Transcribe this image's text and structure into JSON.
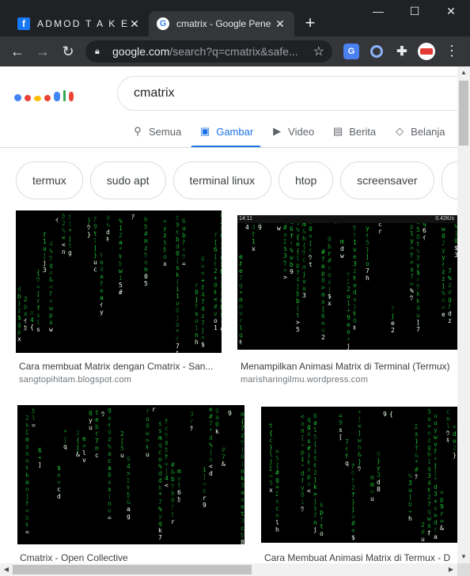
{
  "browser": {
    "tabs": [
      {
        "title": "ADMOD T A K E W A",
        "favicon": "facebook-icon"
      },
      {
        "title": "cmatrix - Google Pene",
        "favicon": "google-icon"
      }
    ],
    "url_domain": "google.com",
    "url_rest": "/search?q=cmatrix&safe...",
    "window_controls": [
      "minimize-icon",
      "maximize-icon",
      "close-icon"
    ]
  },
  "search": {
    "query": "cmatrix",
    "tabs": [
      {
        "label": "Semua",
        "icon": "search-icon"
      },
      {
        "label": "Gambar",
        "icon": "image-icon",
        "active": true
      },
      {
        "label": "Video",
        "icon": "play-icon"
      },
      {
        "label": "Berita",
        "icon": "news-icon"
      },
      {
        "label": "Belanja",
        "icon": "tag-icon"
      }
    ],
    "chips": [
      "termux",
      "sudo apt",
      "terminal linux",
      "htop",
      "screensaver"
    ]
  },
  "results": [
    {
      "caption": "Cara membuat Matrix dengan Cmatrix - San...",
      "domain": "sangtopihitam.blogspot.com"
    },
    {
      "caption": "Menampilkan Animasi Matrix di Terminal (Termux)",
      "domain": "marisharingilmu.wordpress.com",
      "phone_time": "14:11",
      "phone_status": "0.42K/s"
    },
    {
      "caption": "Cmatrix - Open Collective",
      "domain": ""
    },
    {
      "caption": "Cara Membuat Animasi Matrix di Termux - D",
      "domain": ""
    }
  ],
  "colors": {
    "accent": "#1a73e8",
    "matrix_green": "#1fd139",
    "chrome_dark": "#202124",
    "chrome_toolbar": "#35363a"
  }
}
